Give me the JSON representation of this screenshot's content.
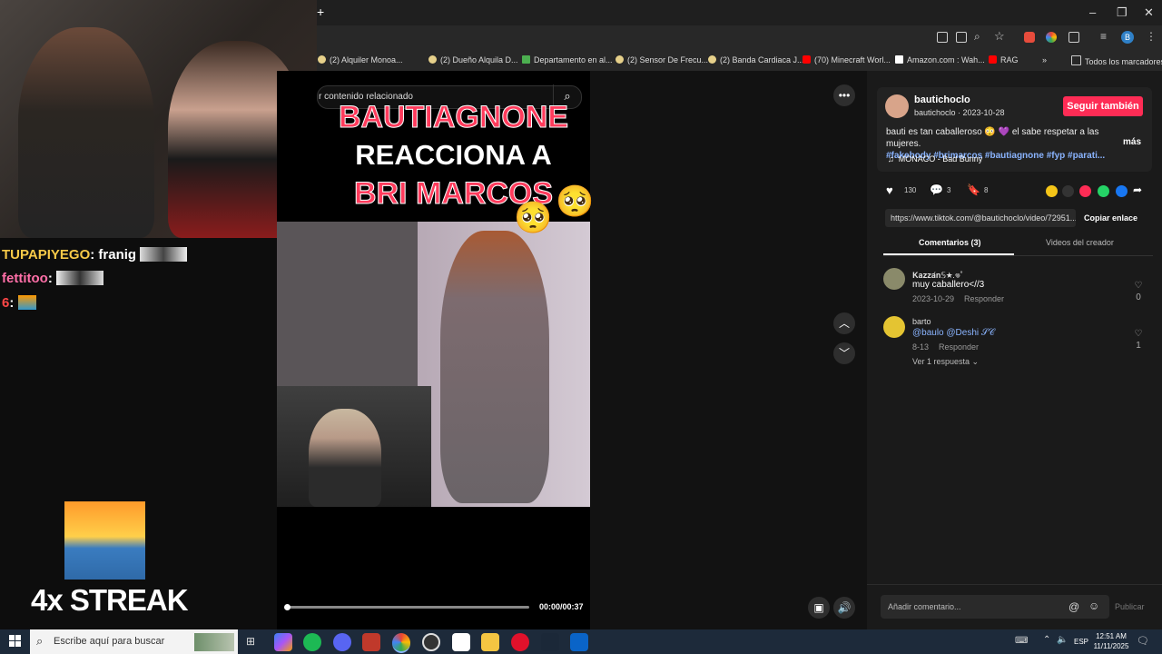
{
  "bookmarks": [
    "(2) Alquiler Monoa...",
    "(2) Dueño Alquila D...",
    "Departamento en al...",
    "(2) Sensor De Frecu...",
    "(2) Banda Cardiaca J...",
    "(70) Minecraft Worl...",
    "Amazon.com : Wah...",
    "RAG"
  ],
  "bookmarks_all": "Todos los marcadores",
  "chat": [
    {
      "user": "TUPAPIYEGO",
      "msg": ": franig",
      "color": "#f7c948"
    },
    {
      "user": "fettitoo",
      "msg": ":",
      "color": "#ff6fa8"
    },
    {
      "user": "6",
      "msg": ":",
      "color": "#ff4747"
    }
  ],
  "streak": "4x STREAK",
  "video": {
    "search_placeholder": "r contenido relacionado",
    "title_line1": "BAUTIAGNONE",
    "title_line2": "REACCIONA A",
    "title_line3": "BRI MARCOS",
    "time": "00:00/00:37",
    "progress": 0.0
  },
  "post": {
    "author": "bautichoclo",
    "author_sub": "bautichoclo · 2023-10-28",
    "follow": "Seguir también",
    "desc_text": "bauti es tan caballeroso 😳 💜 el sabe respetar a las mujeres.",
    "desc_tags": "#fakebody #brimarcos #bautiagnone #fyp #parati...",
    "more": "más",
    "music": "MONACO - Bad Bunny",
    "likes": "130",
    "comments": "3",
    "saves": "8",
    "link": "https://www.tiktok.com/@bautichoclo/video/72951...",
    "copy_link": "Copiar enlace",
    "tab_comments": "Comentarios (3)",
    "tab_creator": "Videos del creador"
  },
  "comments": [
    {
      "name": "𝐊𝐚𝐳𝐳𝐚́𝐧𝕊★.𖦹˚",
      "text": "muy caballero<//3",
      "date": "2023-10-29",
      "reply": "Responder",
      "likes": "0"
    },
    {
      "name": "barto",
      "text": "@baulo @Deshi 𝒮𝒞",
      "date": "8-13",
      "reply": "Responder",
      "likes": "1"
    }
  ],
  "view_replies": "Ver 1 respuesta",
  "comment_placeholder": "Añadir comentario...",
  "post_button": "Publicar",
  "taskbar": {
    "search": "Escribe aquí para buscar",
    "lang": "ESP",
    "time": "12:51 AM",
    "date": "11/11/2025"
  },
  "colors": {
    "follow": "#fe2c55",
    "tags": "#8ab4ff",
    "taskbar": "#1d2a3a"
  }
}
